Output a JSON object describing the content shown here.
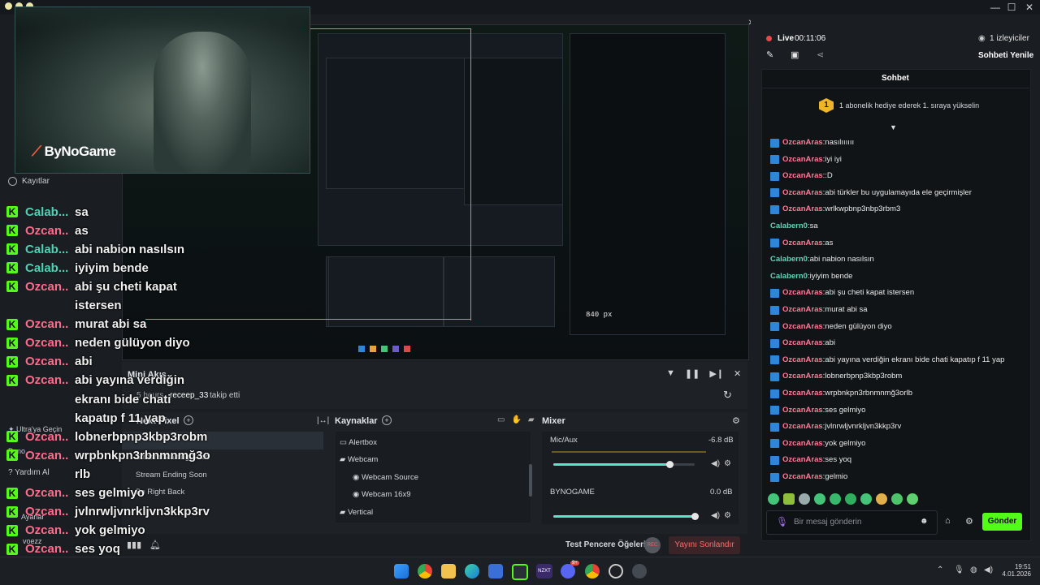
{
  "titlebar": {
    "chevron": "›",
    "minimize": "—",
    "maximize": "☐",
    "close": "✕"
  },
  "webcam": {
    "logo": "ByNoGame"
  },
  "left_sidebar": {
    "recordings_label": "Kayıtlar",
    "ultra_label": "Ultra'ya Geçin",
    "pano_label": "Pano",
    "help_label": "Yardım Al",
    "settings_label": "Ayarlar",
    "username": "voezz"
  },
  "overlay_chat": [
    {
      "user": "Calab...",
      "type": "cal",
      "msg": "sa"
    },
    {
      "user": "Ozcan...",
      "type": "ozc",
      "msg": "as"
    },
    {
      "user": "Calab...",
      "type": "cal",
      "msg": "abi nabion nasılsın"
    },
    {
      "user": "Calab...",
      "type": "cal",
      "msg": "iyiyim bende"
    },
    {
      "user": "Ozcan...",
      "type": "ozc",
      "msg": "abi şu cheti kapat"
    },
    {
      "user": "",
      "type": "ozc",
      "msg": "istersen"
    },
    {
      "user": "Ozcan...",
      "type": "ozc",
      "msg": "murat abi sa"
    },
    {
      "user": "Ozcan...",
      "type": "ozc",
      "msg": "neden gülüyon diyo"
    },
    {
      "user": "Ozcan...",
      "type": "ozc",
      "msg": "abi"
    },
    {
      "user": "Ozcan...",
      "type": "ozc",
      "msg": "abi yayına verdiğin"
    },
    {
      "user": "",
      "type": "ozc",
      "msg": "ekranı bide chati"
    },
    {
      "user": "",
      "type": "ozc",
      "msg": "kapatıp f 11 yap"
    },
    {
      "user": "Ozcan...",
      "type": "ozc",
      "msg": "lobnerbpnp3kbp3robm"
    },
    {
      "user": "Ozcan...",
      "type": "ozc",
      "msg": "wrpbnkpn3rbnmnmğ3o"
    },
    {
      "user": "",
      "type": "ozc",
      "msg": "rlb"
    },
    {
      "user": "Ozcan...",
      "type": "ozc",
      "msg": "ses gelmiyo"
    },
    {
      "user": "Ozcan...",
      "type": "ozc",
      "msg": "jvlnrwljvnrkljvn3kkp3rv"
    },
    {
      "user": "Ozcan...",
      "type": "ozc",
      "msg": "yok gelmiyo"
    },
    {
      "user": "Ozcan...",
      "type": "ozc",
      "msg": "ses yoq"
    },
    {
      "user": "Ozcan...",
      "type": "ozc",
      "msg": "gelmio"
    }
  ],
  "preview": {
    "size_label": "840 px"
  },
  "mini_activity": {
    "title": "Mini Akış",
    "time": "5 hours",
    "user": "receep_33",
    "action": "takip etti"
  },
  "docks": {
    "scenes_title": "Next Pixel",
    "scenes": [
      "Stream Starting Soon",
      "Stream Ending Soon",
      "Be Right Back"
    ],
    "sources_title": "Kaynaklar",
    "sources": [
      {
        "name": "Alertbox",
        "icon": "display"
      },
      {
        "name": "Webcam",
        "icon": "folder"
      },
      {
        "name": "Webcam Source",
        "icon": "camera"
      },
      {
        "name": "Webcam 16x9",
        "icon": "camera"
      },
      {
        "name": "Vertical",
        "icon": "folder"
      }
    ],
    "mixer_title": "Mixer",
    "mixer": [
      {
        "name": "Mic/Aux",
        "db": "-6.8 dB",
        "level": 0.82
      },
      {
        "name": "BYNOGAME",
        "db": "0.0 dB",
        "level": 1.0
      }
    ]
  },
  "bottom_bar": {
    "test_label": "Test Pencere Öğeleri",
    "rec_label": "REC",
    "end_stream": "Yayını Sonlandır"
  },
  "right_panel": {
    "live_label": "Live",
    "live_time": "00:11:06",
    "viewers": "1 izleyiciler",
    "refresh_chat": "Sohbeti Yenile",
    "chat_title": "Sohbet",
    "goal_number": "1",
    "goal_text": "1 abonelik hediye ederek 1. sıraya yükselin",
    "messages": [
      {
        "user": "OzcanAras",
        "type": "ozc",
        "msg": "nasılıııııı"
      },
      {
        "user": "OzcanAras",
        "type": "ozc",
        "msg": "iyi iyi"
      },
      {
        "user": "OzcanAras",
        "type": "ozc",
        "msg": ":D"
      },
      {
        "user": "OzcanAras",
        "type": "ozc",
        "msg": "abi türkler bu uygulamayıda ele geçirmişler"
      },
      {
        "user": "OzcanAras",
        "type": "ozc",
        "msg": "wrlkwpbnp3nbp3rbm3"
      },
      {
        "user": "Calabern0",
        "type": "cal",
        "msg": "sa"
      },
      {
        "user": "OzcanAras",
        "type": "ozc",
        "msg": "as"
      },
      {
        "user": "Calabern0",
        "type": "cal",
        "msg": "abi nabion nasılsın"
      },
      {
        "user": "Calabern0",
        "type": "cal",
        "msg": "iyiyim bende"
      },
      {
        "user": "OzcanAras",
        "type": "ozc",
        "msg": "abi şu cheti kapat istersen"
      },
      {
        "user": "OzcanAras",
        "type": "ozc",
        "msg": "murat abi sa"
      },
      {
        "user": "OzcanAras",
        "type": "ozc",
        "msg": "neden gülüyon diyo"
      },
      {
        "user": "OzcanAras",
        "type": "ozc",
        "msg": "abi"
      },
      {
        "user": "OzcanAras",
        "type": "ozc",
        "msg": "abi yayına verdiğin ekranı bide chati kapatıp f 11 yap"
      },
      {
        "user": "OzcanAras",
        "type": "ozc",
        "msg": "lobnerbpnp3kbp3robm"
      },
      {
        "user": "OzcanAras",
        "type": "ozc",
        "msg": "wrpbnkpn3rbnmnmğ3orlb"
      },
      {
        "user": "OzcanAras",
        "type": "ozc",
        "msg": "ses gelmiyo"
      },
      {
        "user": "OzcanAras",
        "type": "ozc",
        "msg": "jvlnrwljvnrkljvn3kkp3rv"
      },
      {
        "user": "OzcanAras",
        "type": "ozc",
        "msg": "yok gelmiyo"
      },
      {
        "user": "OzcanAras",
        "type": "ozc",
        "msg": "ses yoq"
      },
      {
        "user": "OzcanAras",
        "type": "ozc",
        "msg": "gelmio"
      }
    ],
    "input_placeholder": "Bir mesaj gönderin",
    "send_label": "Gönder"
  },
  "taskbar": {
    "time": "19:51",
    "date": "4.01.2026",
    "discord_badge": "9+"
  },
  "colors": {
    "kick_green": "#53fc18",
    "accent": "#5de3c6",
    "danger": "#d9534f"
  }
}
